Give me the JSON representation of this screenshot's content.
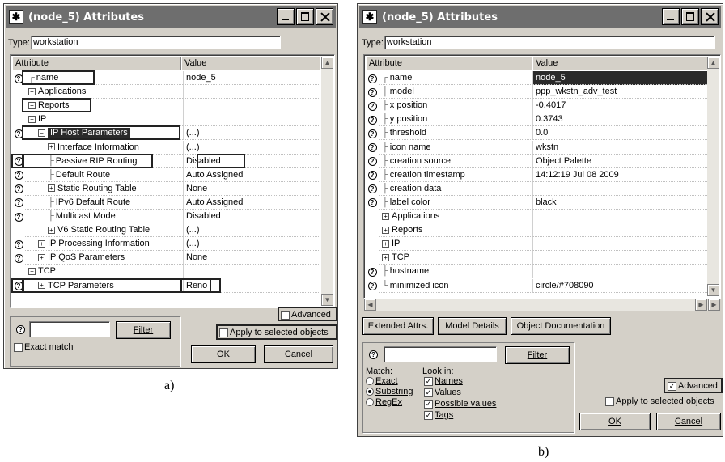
{
  "windowA": {
    "title": "(node_5) Attributes",
    "type_label": "Type:",
    "type_value": "workstation",
    "col_attribute": "Attribute",
    "col_value": "Value",
    "rows": [
      {
        "help": true,
        "indent": 0,
        "tree": "┌",
        "expander": "",
        "label": "name",
        "value": "node_5"
      },
      {
        "help": false,
        "indent": 0,
        "tree": "",
        "expander": "⊞",
        "label": "Applications",
        "value": ""
      },
      {
        "help": false,
        "indent": 0,
        "tree": "",
        "expander": "⊞",
        "label": "Reports",
        "value": ""
      },
      {
        "help": false,
        "indent": 0,
        "tree": "",
        "expander": "⊟",
        "label": "IP",
        "value": ""
      },
      {
        "help": true,
        "indent": 1,
        "tree": "",
        "expander": "⊟",
        "label": "IP Host Parameters",
        "value": "(...)",
        "selected": true
      },
      {
        "help": false,
        "indent": 2,
        "tree": "",
        "expander": "⊞",
        "label": "Interface Information",
        "value": "(...)"
      },
      {
        "help": true,
        "indent": 2,
        "tree": "├",
        "expander": "",
        "label": "Passive RIP Routing",
        "value": "Disabled"
      },
      {
        "help": true,
        "indent": 2,
        "tree": "├",
        "expander": "",
        "label": "Default Route",
        "value": "Auto Assigned"
      },
      {
        "help": true,
        "indent": 2,
        "tree": "",
        "expander": "⊞",
        "label": "Static Routing Table",
        "value": "None"
      },
      {
        "help": true,
        "indent": 2,
        "tree": "├",
        "expander": "",
        "label": "IPv6 Default Route",
        "value": "Auto Assigned"
      },
      {
        "help": true,
        "indent": 2,
        "tree": "├",
        "expander": "",
        "label": "Multicast Mode",
        "value": "Disabled"
      },
      {
        "help": false,
        "indent": 2,
        "tree": "",
        "expander": "⊞",
        "label": "V6 Static Routing Table",
        "value": "(...)"
      },
      {
        "help": true,
        "indent": 1,
        "tree": "",
        "expander": "⊞",
        "label": "IP Processing Information",
        "value": "(...)"
      },
      {
        "help": true,
        "indent": 1,
        "tree": "",
        "expander": "⊞",
        "label": "IP QoS Parameters",
        "value": "None"
      },
      {
        "help": false,
        "indent": 0,
        "tree": "",
        "expander": "⊟",
        "label": "TCP",
        "value": ""
      },
      {
        "help": true,
        "indent": 1,
        "tree": "",
        "expander": "⊞",
        "label": "TCP Parameters",
        "value": "Reno"
      }
    ],
    "advanced_label": "Advanced",
    "advanced_checked": false,
    "filter_label": "Filter",
    "filter_value": "",
    "apply_label": "Apply to selected objects",
    "apply_checked": false,
    "exact_match_label": "Exact match",
    "exact_match_checked": false,
    "ok_label": "OK",
    "cancel_label": "Cancel"
  },
  "windowB": {
    "title": "(node_5) Attributes",
    "type_label": "Type:",
    "type_value": "workstation",
    "col_attribute": "Attribute",
    "col_value": "Value",
    "rows": [
      {
        "help": true,
        "tree": "┌",
        "expander": "",
        "label": "name",
        "value": "node_5",
        "selected": true
      },
      {
        "help": true,
        "tree": "├",
        "expander": "",
        "label": "model",
        "value": "ppp_wkstn_adv_test"
      },
      {
        "help": true,
        "tree": "├",
        "expander": "",
        "label": "x position",
        "value": "-0.4017"
      },
      {
        "help": true,
        "tree": "├",
        "expander": "",
        "label": "y position",
        "value": "0.3743"
      },
      {
        "help": true,
        "tree": "├",
        "expander": "",
        "label": "threshold",
        "value": "0.0"
      },
      {
        "help": true,
        "tree": "├",
        "expander": "",
        "label": "icon name",
        "value": "wkstn"
      },
      {
        "help": true,
        "tree": "├",
        "expander": "",
        "label": "creation source",
        "value": "Object Palette"
      },
      {
        "help": true,
        "tree": "├",
        "expander": "",
        "label": "creation timestamp",
        "value": "14:12:19 Jul 08 2009"
      },
      {
        "help": true,
        "tree": "├",
        "expander": "",
        "label": "creation data",
        "value": ""
      },
      {
        "help": true,
        "tree": "├",
        "expander": "",
        "label": "label color",
        "value": "black"
      },
      {
        "help": false,
        "tree": "",
        "expander": "⊞",
        "label": "Applications",
        "value": ""
      },
      {
        "help": false,
        "tree": "",
        "expander": "⊞",
        "label": "Reports",
        "value": ""
      },
      {
        "help": false,
        "tree": "",
        "expander": "⊞",
        "label": "IP",
        "value": ""
      },
      {
        "help": false,
        "tree": "",
        "expander": "⊞",
        "label": "TCP",
        "value": ""
      },
      {
        "help": true,
        "tree": "├",
        "expander": "",
        "label": "hostname",
        "value": ""
      },
      {
        "help": true,
        "tree": "└",
        "expander": "",
        "label": "minimized icon",
        "value": "circle/#708090"
      }
    ],
    "extended_attrs_label": "Extended Attrs.",
    "model_details_label": "Model Details",
    "object_doc_label": "Object Documentation",
    "filter_label": "Filter",
    "filter_value": "",
    "match_label": "Match:",
    "match_options": [
      "Exact",
      "Substring",
      "RegEx"
    ],
    "match_selected": "Substring",
    "look_in_label": "Look in:",
    "look_in_options": [
      {
        "label": "Names",
        "checked": true
      },
      {
        "label": "Values",
        "checked": true
      },
      {
        "label": "Possible values",
        "checked": true
      },
      {
        "label": "Tags",
        "checked": true
      }
    ],
    "advanced_label": "Advanced",
    "advanced_checked": true,
    "apply_label": "Apply to selected objects",
    "apply_checked": false,
    "ok_label": "OK",
    "cancel_label": "Cancel"
  },
  "captions": {
    "a": "a)",
    "b": "b)"
  }
}
